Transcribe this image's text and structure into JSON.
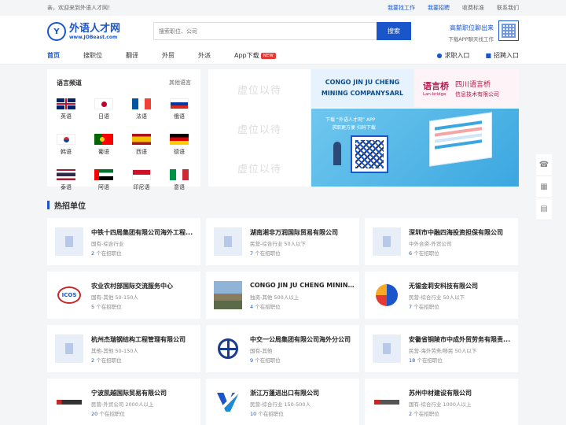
{
  "topbar": {
    "welcome": "亲，欢迎来到外语人才网！",
    "links": [
      "我要找工作",
      "我要招聘",
      "收费标准",
      "联系我们"
    ]
  },
  "header": {
    "logo_cn": "外语人才网",
    "logo_en": "www.JOBeast.com",
    "search_placeholder": "搜索职位、公司",
    "search_button": "搜索",
    "promo_line1": "高薪职位聊出来",
    "promo_line2": "下载APP聊天找工作"
  },
  "nav": {
    "items": [
      "首页",
      "搜职位",
      "翻译",
      "外贸",
      "外派",
      "App下载"
    ],
    "badge": "NEW",
    "right": [
      "求职入口",
      "招聘入口"
    ]
  },
  "languages": {
    "title": "语言频道",
    "other": "其他语言",
    "items": [
      "英语",
      "日语",
      "法语",
      "俄语",
      "韩语",
      "葡语",
      "西语",
      "德语",
      "泰语",
      "阿语",
      "印尼语",
      "意语"
    ]
  },
  "placeholders": [
    "虚位以待",
    "虚位以待",
    "虚位以待"
  ],
  "banners": {
    "b1_line1": "CONGO JIN JU CHENG",
    "b1_line2": "MINING COMPANYSARL",
    "b2_logo": "语言桥",
    "b2_logo_sub": "Lan-bridge",
    "b2_line1": "四川语言桥",
    "b2_line2": "信息技术有限公司",
    "b3_line1": "下载 “外语人才网” APP",
    "b3_line2": "求职更方便  扫码下载"
  },
  "section": {
    "title": "热招单位"
  },
  "companies": [
    {
      "name": "中铁十四局集团有限公司海外工程...",
      "meta": "国有-综合行业",
      "count": "2",
      "suffix": " 个在招职位"
    },
    {
      "name": "湖南湘非万润国际贸易有限公司",
      "meta": "民营-综合行业   50人以下",
      "count": "7",
      "suffix": " 个在招职位"
    },
    {
      "name": "深圳市中融四海投资担保有限公司",
      "meta": "中外合资-外贸公司",
      "count": "6",
      "suffix": " 个在招职位"
    },
    {
      "name": "农业农村部国际交流服务中心",
      "meta": "国有-其他   50-150人",
      "count": "5",
      "suffix": " 个在招职位"
    },
    {
      "name": "CONGO JIN JU CHENG MINING...",
      "meta": "独资-其他   500人以上",
      "count": "4",
      "suffix": " 个在招职位"
    },
    {
      "name": "无锡金莉安科技有限公司",
      "meta": "民营-综合行业   50人以下",
      "count": "7",
      "suffix": " 个在招职位"
    },
    {
      "name": "杭州杰瑞钢结构工程管理有限公司",
      "meta": "其他-其他   50-150人",
      "count": "2",
      "suffix": " 个在招职位"
    },
    {
      "name": "中交一公局集团有限公司海外分公司",
      "meta": "国有-其他",
      "count": "9",
      "suffix": " 个在招职位"
    },
    {
      "name": "安徽省铜陵市中成外贸劳务有限责...",
      "meta": "民营-海外劳务/移民   50人以下",
      "count": "18",
      "suffix": " 个在招职位"
    },
    {
      "name": "宁波凯越国际贸易有限公司",
      "meta": "民营-外贸公司   2000人以上",
      "count": "20",
      "suffix": " 个在招职位"
    },
    {
      "name": "浙江万蓬进出口有限公司",
      "meta": "民营-综合行业   150-500人",
      "count": "10",
      "suffix": " 个在招职位"
    },
    {
      "name": "苏州中材建设有限公司",
      "meta": "国有-综合行业   1000人以上",
      "count": "2",
      "suffix": " 个在招职位"
    }
  ]
}
